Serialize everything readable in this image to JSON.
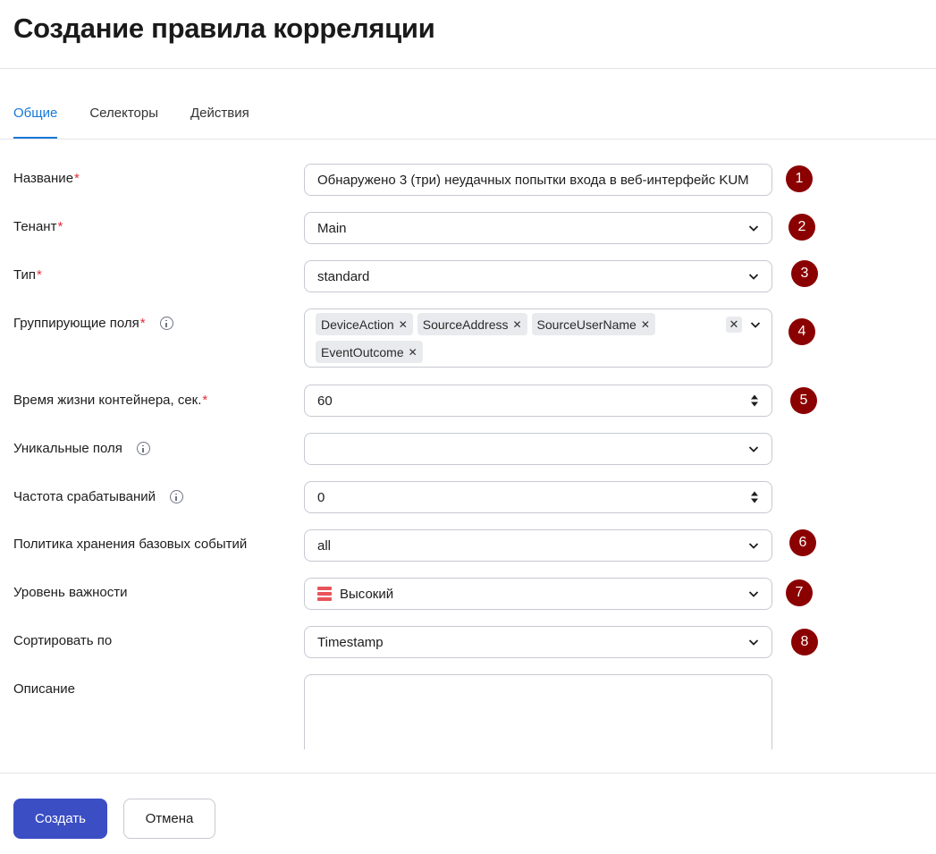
{
  "page": {
    "title": "Создание правила корреляции"
  },
  "tabs": [
    {
      "label": "Общие",
      "active": true
    },
    {
      "label": "Селекторы",
      "active": false
    },
    {
      "label": "Действия",
      "active": false
    }
  ],
  "form": {
    "name": {
      "label": "Название",
      "required": "*",
      "value": "Обнаружено 3 (три) неудачных попытки входа в веб-интерфейс KUM"
    },
    "tenant": {
      "label": "Тенант",
      "required": "*",
      "value": "Main"
    },
    "type": {
      "label": "Тип",
      "required": "*",
      "value": "standard"
    },
    "grouping_fields": {
      "label": "Группирующие поля",
      "required": "*",
      "tags": [
        "DeviceAction",
        "SourceAddress",
        "SourceUserName",
        "EventOutcome"
      ],
      "clear_symbol": "✕",
      "remove_symbol": "✕"
    },
    "container_lifetime": {
      "label": "Время жизни контейнера, сек.",
      "required": "*",
      "value": "60"
    },
    "unique_fields": {
      "label": "Уникальные поля",
      "value": ""
    },
    "trigger_rate": {
      "label": "Частота срабатываний",
      "value": "0"
    },
    "base_events_policy": {
      "label": "Политика хранения базовых событий",
      "value": "all"
    },
    "severity": {
      "label": "Уровень важности",
      "value": "Высокий",
      "color": "#e8545a"
    },
    "sort_by": {
      "label": "Сортировать по",
      "value": "Timestamp"
    },
    "description": {
      "label": "Описание",
      "value": ""
    }
  },
  "badges": [
    "1",
    "2",
    "3",
    "4",
    "5",
    "6",
    "7",
    "8"
  ],
  "footer": {
    "create_label": "Создать",
    "cancel_label": "Отмена"
  },
  "colors": {
    "accent": "#1778d8",
    "primary_button": "#3b4ec4",
    "required": "#e0303c",
    "badge": "#8b0000"
  }
}
